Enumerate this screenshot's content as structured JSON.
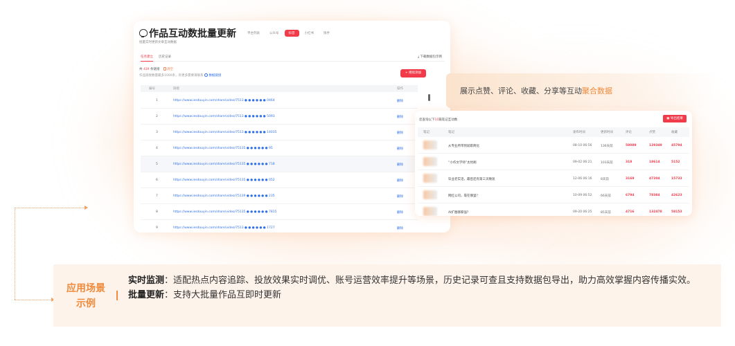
{
  "colors": {
    "accent": "#f23b4a",
    "link": "#2f6fe8",
    "highlight": "#f08a3c"
  },
  "main": {
    "title": "作品互动数批量更新",
    "platform_tabs": [
      "平台列表",
      "公众号",
      "抖音",
      "小红书",
      "快手"
    ],
    "active_platform": "抖音",
    "subtitle": "批量实时更新文章互动数据",
    "tabs": [
      "任务建立",
      "历史记录"
    ],
    "download_label": "⤓ 下载数据包示例",
    "count_prefix": "共",
    "count_value": "439",
    "count_suffix": "条链接",
    "clear_label": "清空",
    "limit_text": "作品链接数量最多1000条，有更多需要请联系",
    "limit_link": "数据链接",
    "add_button": "+ 继续添加",
    "table_headers": {
      "num": "编号",
      "link": "链接",
      "action": "操作"
    },
    "rows": [
      {
        "num": "1",
        "url": "https://www.iesdouyin.com/share/video/7513 ● ● ● ● ● ● 0464",
        "action": "删除"
      },
      {
        "num": "2",
        "url": "https://www.iesdouyin.com/share/video/7513 ● ● ● ● ● ● 5093",
        "action": "删除"
      },
      {
        "num": "3",
        "url": "https://www.iesdouyin.com/share/video/7513 ● ● ● ● ● ● 14035",
        "action": "删除"
      },
      {
        "num": "4",
        "url": "https://www.iesdouyin.com/share/video/75135 ● ● ● ● ● ● 95",
        "action": "删除"
      },
      {
        "num": "5",
        "url": "https://www.iesdouyin.com/share/video/75135 ● ● ● ● ● ● 718",
        "action": "删除"
      },
      {
        "num": "6",
        "url": "https://www.iesdouyin.com/share/video/75135 ● ● ● ● ● ● 052",
        "action": "删除"
      },
      {
        "num": "7",
        "url": "https://www.iesdouyin.com/share/video/75139 ● ● ● ● ● ● 235",
        "action": "删除"
      },
      {
        "num": "8",
        "url": "https://www.iesdouyin.com/share/video/75135 ● ● ● ● ● ● 7815",
        "action": "删除"
      },
      {
        "num": "9",
        "url": "https://www.iesdouyin.com/share/video/7513 ● ● ● ● ● ● 1727",
        "action": "删除"
      }
    ]
  },
  "callout": {
    "text_before": "展示点赞、评论、收藏、分享等互动",
    "text_highlight": "聚合数据"
  },
  "result": {
    "head_prefix": "您查询以下",
    "head_count": "10",
    "head_suffix": "篇笔记互动数",
    "export_button": "导出结果",
    "headers": [
      "笔记",
      "笔记",
      "发布时间",
      "更新时间",
      "评论",
      "点赞",
      "收藏"
    ],
    "rows": [
      {
        "title": "从专业所带到就职简化",
        "time": "08-10 06:56",
        "updated": "136天前",
        "comments": "58089",
        "likes": "129349",
        "favs": "45794"
      },
      {
        "title": "“小作文学师”太坑啊",
        "time": "09-02 06:21",
        "updated": "103天前",
        "comments": "318",
        "likes": "18614",
        "favs": "5152"
      },
      {
        "title": "毕业老实话，最后还有第三天晚饭",
        "time": "12-06 06:16",
        "updated": "8天前",
        "comments": "3169",
        "likes": "47204",
        "favs": "15733"
      },
      {
        "title": "网红公司，靠在哪里？",
        "time": "10-09 06:52",
        "updated": "66天前",
        "comments": "6794",
        "likes": "78384",
        "favs": "42623"
      },
      {
        "title": "AI扩图哪家强？",
        "time": "09-20 06:25",
        "updated": "85天前",
        "comments": "4716",
        "likes": "132478",
        "favs": "58153"
      }
    ]
  },
  "scenario": {
    "label_line1": "应用场景",
    "label_line2": "示例",
    "item1_title": "实时监测",
    "item1_text": "：适配热点内容追踪、投放效果实时调优、账号运营效率提升等场景，历史记录可查且支持数据包导出，助力高效掌握内容传播实效。",
    "item2_title": "批量更新",
    "item2_text": "：支持大批量作品互即时更新"
  }
}
